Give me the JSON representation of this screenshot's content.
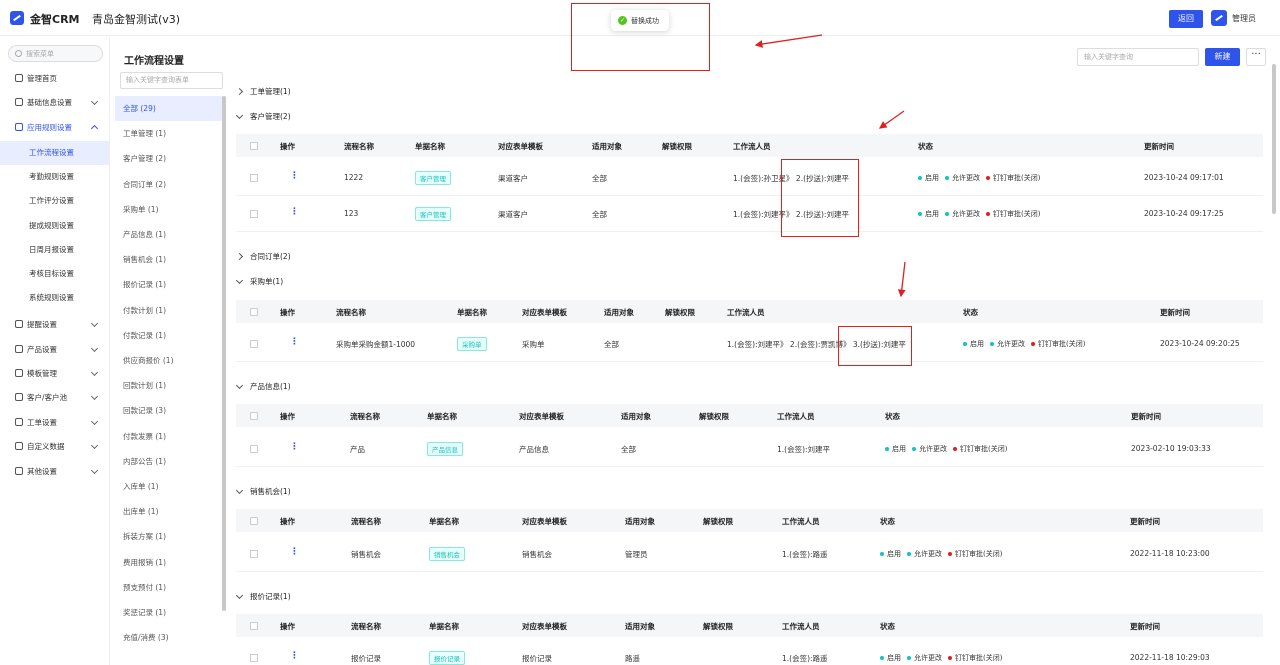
{
  "header": {
    "app_name": "金智CRM",
    "project_name": "青岛金智测试(v3)",
    "toast_text": "替换成功",
    "back_label": "返回",
    "user_name": "管理员"
  },
  "sidebar": {
    "search_placeholder": "搜索菜单",
    "items": [
      {
        "label": "管理首页",
        "icon": "home-icon"
      },
      {
        "label": "基础信息设置",
        "icon": "settings-icon"
      },
      {
        "label": "应用规则设置",
        "icon": "rules-icon"
      },
      {
        "label": "提醒设置",
        "icon": "bell-icon"
      },
      {
        "label": "产品设置",
        "icon": "product-icon"
      },
      {
        "label": "模板管理",
        "icon": "template-icon"
      },
      {
        "label": "客户/客户池",
        "icon": "customer-icon"
      },
      {
        "label": "工单设置",
        "icon": "ticket-icon"
      },
      {
        "label": "自定义数据",
        "icon": "custom-data-icon"
      },
      {
        "label": "其他设置",
        "icon": "grid-icon"
      }
    ],
    "sub_items": [
      "工作流程设置",
      "考勤规则设置",
      "工作评分设置",
      "提成规则设置",
      "日周月报设置",
      "考核目标设置",
      "系统规则设置"
    ]
  },
  "main": {
    "title": "工作流程设置",
    "search_placeholder": "输入关键字查询",
    "new_label": "新建",
    "more_label": "···"
  },
  "categories": {
    "search_placeholder": "输入关键字查询表单",
    "items": [
      "全部 (29)",
      "工单管理 (1)",
      "客户管理 (2)",
      "合同订单 (2)",
      "采购单 (1)",
      "产品信息 (1)",
      "销售机会 (1)",
      "报价记录 (1)",
      "付款计划 (1)",
      "付款记录 (1)",
      "供应商报价 (1)",
      "回款计划 (1)",
      "回款记录 (3)",
      "付款发票 (1)",
      "内部公告 (1)",
      "入库单 (1)",
      "出库单 (1)",
      "拆装方案 (1)",
      "费用报销 (1)",
      "预支预付 (1)",
      "奖惩记录 (1)",
      "充值/消费 (3)"
    ]
  },
  "table_headers": [
    "操作",
    "流程名称",
    "单据名称",
    "对应表单模板",
    "适用对象",
    "解锁权限",
    "工作流人员",
    "状态",
    "更新时间"
  ],
  "sections": [
    {
      "title": "工单管理(1)",
      "expanded": false
    },
    {
      "title": "客户管理(2)",
      "expanded": true,
      "rows": [
        {
          "name": "1222",
          "doc": "客户管理",
          "template": "渠道客户",
          "target": "全部",
          "unlock": "",
          "workers": "1.(会签):孙卫星》 2.(抄送):刘建平",
          "updated": "2023-10-24 09:17:01"
        },
        {
          "name": "123",
          "doc": "客户管理",
          "template": "渠道客户",
          "target": "全部",
          "unlock": "",
          "workers": "1.(会签):刘建平》 2.(抄送):刘建平",
          "updated": "2023-10-24 09:17:25"
        }
      ]
    },
    {
      "title": "合同订单(2)",
      "expanded": false
    },
    {
      "title": "采购单(1)",
      "expanded": true,
      "rows": [
        {
          "name": "采购单采购金额1-1000",
          "doc": "采购单",
          "template": "采购单",
          "target": "全部",
          "unlock": "",
          "workers": "1.(会签):刘建平》 2.(会签):贾凯博》 3.(抄送):刘建平",
          "updated": "2023-10-24 09:20:25"
        }
      ]
    },
    {
      "title": "产品信息(1)",
      "expanded": true,
      "rows": [
        {
          "name": "产品",
          "doc": "产品信息",
          "template": "产品信息",
          "target": "全部",
          "unlock": "",
          "workers": "1.(会签):刘建平",
          "updated": "2023-02-10 19:03:33"
        }
      ]
    },
    {
      "title": "销售机会(1)",
      "expanded": true,
      "rows": [
        {
          "name": "销售机会",
          "doc": "销售机会",
          "template": "销售机会",
          "target": "管理员",
          "unlock": "",
          "workers": "1.(会签):路遥",
          "updated": "2022-11-18 10:23:00"
        }
      ]
    },
    {
      "title": "报价记录(1)",
      "expanded": true,
      "rows": [
        {
          "name": "报价记录",
          "doc": "报价记录",
          "template": "报价记录",
          "target": "路遥",
          "unlock": "",
          "workers": "1.(会签):路遥",
          "updated": "2022-11-18 10:29:03"
        }
      ]
    }
  ],
  "status_labels": {
    "enabled": "启用",
    "allow_change": "允许更改",
    "dingtalk": "钉钉审批(关闭)"
  },
  "colors": {
    "primary": "#2f54eb",
    "success": "#52c41a",
    "teal": "#13c2c2",
    "danger": "#e02020"
  }
}
